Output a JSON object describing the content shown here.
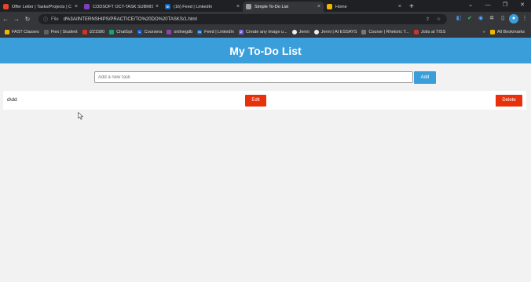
{
  "browser": {
    "tabs": [
      {
        "title": "Offer Letter | Tasks/Projects | C",
        "icon_color": "#e6452a",
        "active": false
      },
      {
        "title": "CODSOFT OCT-TASK SUBMISSI",
        "icon_color": "#7b3fbf",
        "active": false
      },
      {
        "title": "(16) Feed | LinkedIn",
        "icon_color": "#0a66c2",
        "icon_text": "in",
        "active": false
      },
      {
        "title": "Simple To-Do List",
        "icon_color": "#9aa0a6",
        "active": true
      },
      {
        "title": "Home",
        "icon_color": "#f2b600",
        "active": false
      }
    ],
    "new_tab_label": "+",
    "url": {
      "protocol": "File",
      "path": "d%3A/INTERNSHIPS/PRACTICE/TO%20DO%20TASKS/1.html"
    },
    "bookmarks": [
      {
        "label": "FAST Classes",
        "icon_color": "#f2b600"
      },
      {
        "label": "Flex | Student",
        "icon_color": "#5f6368"
      },
      {
        "label": "i221580",
        "icon_color": "#d93025"
      },
      {
        "label": "ChatGpt",
        "icon_color": "#10a37f"
      },
      {
        "label": "Coursera",
        "icon_color": "#0056d2",
        "icon_text": "C"
      },
      {
        "label": "onlinegdb",
        "icon_color": "#8e44ad"
      },
      {
        "label": "Feed | LinkedIn",
        "icon_color": "#0a66c2",
        "icon_text": "in"
      },
      {
        "label": "Create any image u...",
        "icon_color": "#6c5ce7",
        "icon_text": "Z"
      },
      {
        "label": "Jenni",
        "icon_color": "#eeeeee"
      },
      {
        "label": "Jenni | AI ESSAYS",
        "icon_color": "#eeeeee"
      },
      {
        "label": "Course | Rhetoric T...",
        "icon_color": "#777777"
      },
      {
        "label": "Jobs at TISS",
        "icon_color": "#c0392b"
      }
    ],
    "all_bookmarks_label": "All Bookmarks"
  },
  "page": {
    "title": "My To-Do List",
    "new_task_placeholder": "Add a new task",
    "add_label": "Add",
    "tasks": [
      {
        "text": "d\\dd",
        "edit_label": "Edit",
        "delete_label": "Delete"
      }
    ],
    "colors": {
      "header": "#3a9edb",
      "add_button": "#3a9edb",
      "danger": "#e8300b"
    }
  }
}
